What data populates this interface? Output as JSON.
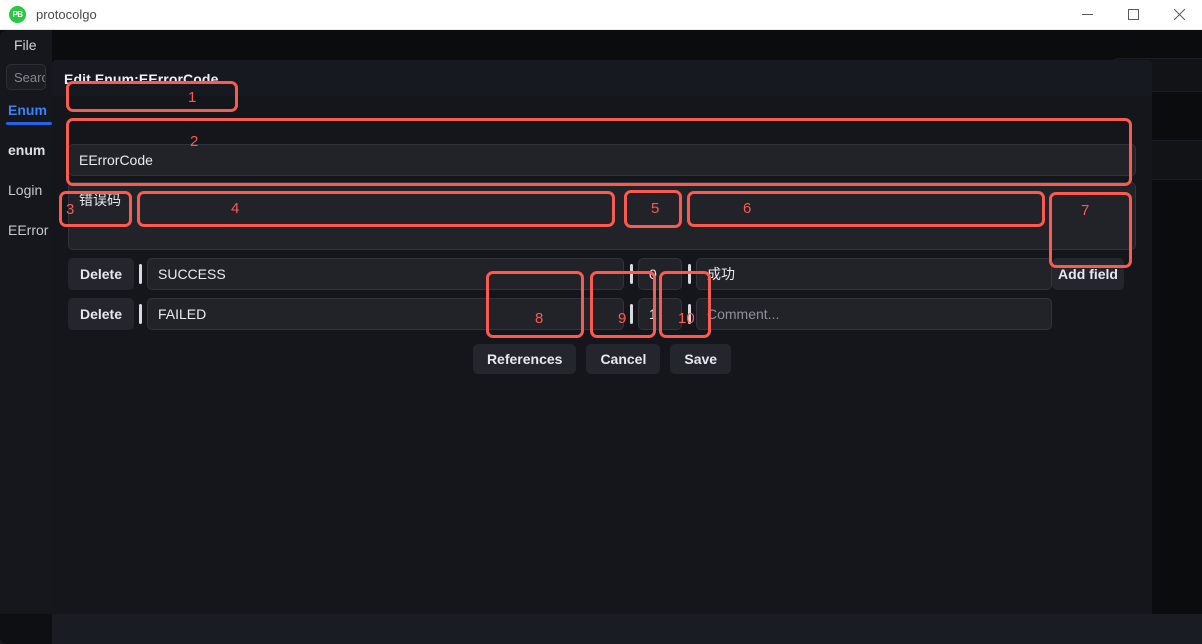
{
  "window": {
    "app_badge": "PB",
    "title": "protocolgo",
    "controls": {
      "minimize": "minimize-icon",
      "maximize": "maximize-icon",
      "close": "close-icon"
    }
  },
  "sidebar": {
    "file_menu": "File",
    "search_placeholder": "Search",
    "items": [
      {
        "label": "Enum",
        "active": true
      },
      {
        "label": "enum",
        "active": false
      },
      {
        "label": "Login",
        "active": false
      },
      {
        "label": "EError",
        "active": false
      }
    ]
  },
  "modal": {
    "title": "Edit Enum:EErrorCode",
    "name_value": "EErrorCode",
    "description_value": "错误码",
    "add_field_label": "Add field",
    "rows": [
      {
        "delete_label": "Delete",
        "name": "SUCCESS",
        "number": "0",
        "comment": "成功",
        "comment_is_placeholder": false
      },
      {
        "delete_label": "Delete",
        "name": "FAILED",
        "number": "1",
        "comment": "Comment...",
        "comment_is_placeholder": true
      }
    ],
    "footer": {
      "references_label": "References",
      "cancel_label": "Cancel",
      "save_label": "Save"
    }
  },
  "annotations": {
    "accent_color": "#fa5a50",
    "marks": [
      {
        "id": "1",
        "target": "name-field"
      },
      {
        "id": "2",
        "target": "description-field"
      },
      {
        "id": "3",
        "target": "delete-button-row-1"
      },
      {
        "id": "4",
        "target": "enum-name-field-row-1"
      },
      {
        "id": "5",
        "target": "enum-number-field-row-1"
      },
      {
        "id": "6",
        "target": "enum-comment-field-row-1"
      },
      {
        "id": "7",
        "target": "add-field-button"
      },
      {
        "id": "8",
        "target": "references-button"
      },
      {
        "id": "9",
        "target": "cancel-button"
      },
      {
        "id": "10",
        "target": "save-button"
      }
    ]
  }
}
